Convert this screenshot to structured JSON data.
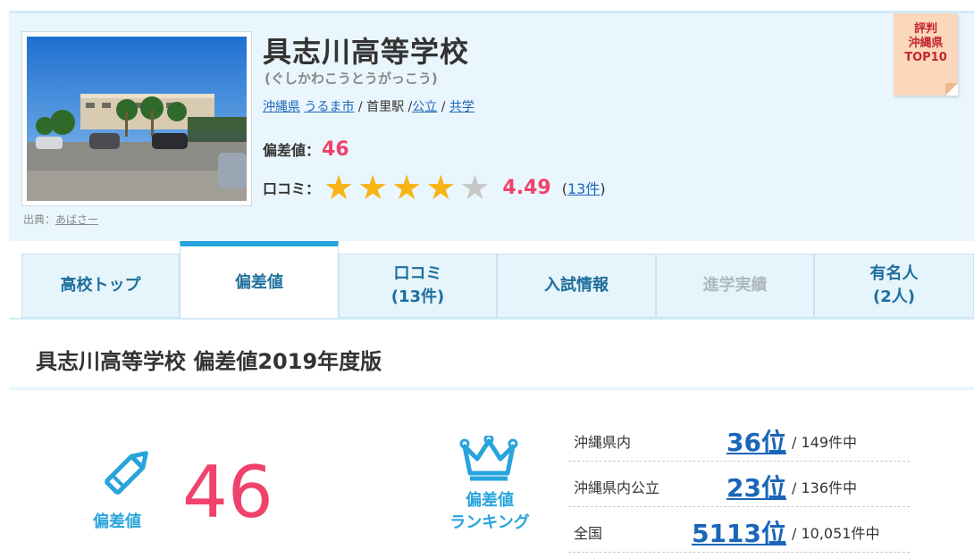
{
  "school": {
    "name": "具志川高等学校",
    "kana": "(ぐしかわこうとうがっこう)",
    "prefecture": "沖縄県",
    "city": "うるま市",
    "station": "首里駅",
    "type": "公立",
    "gender": "共学",
    "sep1": " / ",
    "sep2": " /",
    "sep3": " / "
  },
  "photo_credit": {
    "label": "出典：",
    "source": "あばさー"
  },
  "hensa": {
    "label": "偏差値：",
    "value": "46"
  },
  "review": {
    "label": "口コミ：",
    "rating": 4.49,
    "stars_filled": 4,
    "stars_total": 5,
    "score": "4.49",
    "count_open": "(",
    "count": "13件",
    "count_close": ")"
  },
  "badge": {
    "line1": "評判",
    "line2": "沖縄県",
    "line3": "TOP10"
  },
  "tabs": [
    {
      "line1": "高校トップ",
      "line2": ""
    },
    {
      "line1": "偏差値",
      "line2": ""
    },
    {
      "line1": "口コミ",
      "line2": "(13件)"
    },
    {
      "line1": "入試情報",
      "line2": ""
    },
    {
      "line1": "進学実績",
      "line2": ""
    },
    {
      "line1": "有名人",
      "line2": "(2人)"
    }
  ],
  "section_title": "具志川高等学校 偏差値2019年度版",
  "summary": {
    "pencil_label": "偏差値",
    "big_value": "46",
    "ranking_label_1": "偏差値",
    "ranking_label_2": "ランキング"
  },
  "ranking": [
    {
      "area": "沖縄県内",
      "rank": "36位",
      "total": "/ 149件中"
    },
    {
      "area": "沖縄県内公立",
      "rank": "23位",
      "total": "/ 136件中"
    },
    {
      "area": "全国",
      "rank": "5113位",
      "total": "/ 10,051件中"
    }
  ],
  "colors": {
    "accent": "#27a4dc",
    "score": "#f0426b",
    "link": "#1a66b8",
    "star": "#f7b415"
  }
}
